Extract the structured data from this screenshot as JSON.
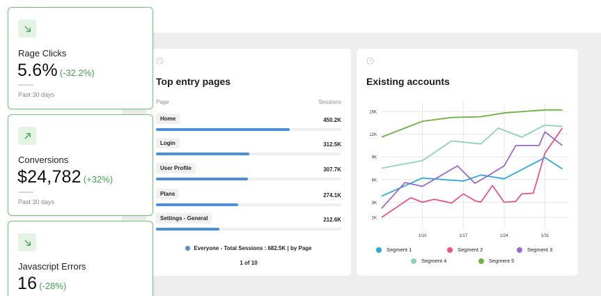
{
  "kpis": [
    {
      "title": "Rage Clicks",
      "value": "5.6%",
      "change": "(-32.2%)",
      "period": "Past 30 days",
      "trend_icon": "arrow-down-right-icon"
    },
    {
      "title": "Conversions",
      "value": "$24,782",
      "change": "(+32%)",
      "period": "Past 30 days",
      "trend_icon": "arrow-up-right-icon"
    },
    {
      "title": "Javascript Errors",
      "value": "16",
      "change": "(-28%)",
      "trend_icon": "arrow-down-right-icon"
    }
  ],
  "top_entry": {
    "title": "Top entry pages",
    "col_page": "Page",
    "col_sessions": "Sessions",
    "rows": [
      {
        "page": "Home",
        "sessions": "450.2K",
        "share": 0.72
      },
      {
        "page": "Login",
        "sessions": "312.5K",
        "share": 0.505
      },
      {
        "page": "User Profile",
        "sessions": "307.7K",
        "share": 0.497
      },
      {
        "page": "Plans",
        "sessions": "274.1K",
        "share": 0.443
      },
      {
        "page": "Settings - General",
        "sessions": "212.6K",
        "share": 0.343
      }
    ],
    "footer": "Everyone -  Total Sessions : 682.5K | by Page",
    "pager": "1 of 10"
  },
  "chart_data": {
    "type": "line",
    "title": "Existing accounts",
    "y_ticks": [
      "15K",
      "12K",
      "9K",
      "6K",
      "3K",
      "1K"
    ],
    "y_tick_values": [
      15,
      12,
      9,
      6,
      3,
      1
    ],
    "x_ticks": [
      "1/10",
      "1/17",
      "1/24",
      "1/31"
    ],
    "x_tick_values": [
      10,
      17,
      24,
      31
    ],
    "xlim": [
      3,
      35
    ],
    "ylim": [
      0,
      15
    ],
    "grid": true,
    "legend_position": "bottom",
    "series": [
      {
        "name": "Segment 1",
        "color": "#29a9e0",
        "x": [
          3,
          10,
          17,
          20,
          24,
          31,
          34
        ],
        "y": [
          3.8,
          6.2,
          5.8,
          6.6,
          6.1,
          8.9,
          7.4
        ]
      },
      {
        "name": "Segment 2",
        "color": "#e8538a",
        "x": [
          3,
          8,
          10,
          12,
          15,
          17,
          19,
          20,
          22,
          24,
          26,
          27,
          29,
          31,
          32,
          34
        ],
        "y": [
          1.0,
          3.6,
          3.0,
          3.4,
          2.9,
          4.1,
          3.2,
          3.0,
          5.2,
          3.0,
          3.1,
          4.1,
          4.2,
          9.5,
          10.6,
          12.8
        ]
      },
      {
        "name": "Segment 3",
        "color": "#9a68c9",
        "x": [
          3,
          7,
          10,
          16,
          19,
          21,
          24,
          26,
          30,
          31,
          34
        ],
        "y": [
          2.2,
          5.6,
          5.1,
          7.8,
          5.5,
          6.4,
          7.8,
          10.5,
          10.5,
          12.3,
          10.5
        ]
      },
      {
        "name": "Segment 4",
        "color": "#8fd3b5",
        "x": [
          3,
          10,
          15,
          20,
          23,
          27,
          31,
          34
        ],
        "y": [
          7.5,
          8.5,
          11.1,
          10.7,
          12.8,
          11.6,
          13.2,
          13.0
        ]
      },
      {
        "name": "Segment 5",
        "color": "#6db33f",
        "x": [
          3,
          10,
          15,
          20,
          24,
          31,
          34
        ],
        "y": [
          11.6,
          13.7,
          14.2,
          14.3,
          14.8,
          15.2,
          15.2
        ]
      }
    ]
  },
  "icons": {
    "panel_clock": "clock-icon"
  }
}
